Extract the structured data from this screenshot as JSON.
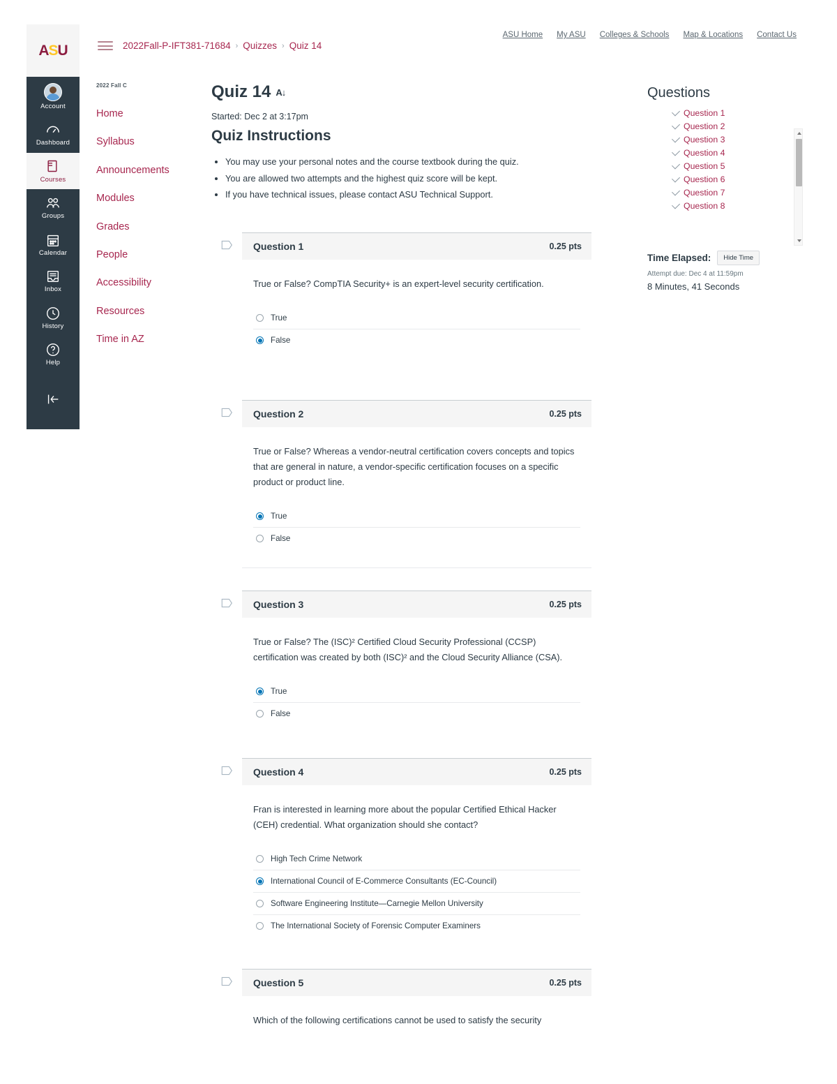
{
  "branding": {
    "logo_text": "ASU",
    "logo_primary_color": "#8C1D40",
    "logo_accent_color": "#FFC627",
    "link_color": "#A7274F",
    "radio_selected_color": "#0374B5"
  },
  "top_links": [
    {
      "label": "ASU Home"
    },
    {
      "label": "My ASU"
    },
    {
      "label": "Colleges & Schools"
    },
    {
      "label": "Map & Locations"
    },
    {
      "label": "Contact Us"
    }
  ],
  "breadcrumb": {
    "course": "2022Fall-P-IFT381-71684",
    "section": "Quizzes",
    "current": "Quiz 14",
    "separator": "›"
  },
  "global_nav": [
    {
      "label": "Account",
      "icon": "avatar-icon"
    },
    {
      "label": "Dashboard",
      "icon": "dashboard-icon"
    },
    {
      "label": "Courses",
      "icon": "courses-icon",
      "active": true
    },
    {
      "label": "Groups",
      "icon": "groups-icon"
    },
    {
      "label": "Calendar",
      "icon": "calendar-icon"
    },
    {
      "label": "Inbox",
      "icon": "inbox-icon"
    },
    {
      "label": "History",
      "icon": "history-icon"
    },
    {
      "label": "Help",
      "icon": "help-icon"
    },
    {
      "label": "",
      "icon": "collapse-arrow-icon"
    }
  ],
  "course_nav": {
    "term": "2022 Fall C",
    "items": [
      {
        "label": "Home"
      },
      {
        "label": "Syllabus"
      },
      {
        "label": "Announcements"
      },
      {
        "label": "Modules"
      },
      {
        "label": "Grades"
      },
      {
        "label": "People"
      },
      {
        "label": "Accessibility"
      },
      {
        "label": "Resources"
      },
      {
        "label": "Time in AZ"
      }
    ]
  },
  "quiz": {
    "title": "Quiz 14",
    "accessibility_icon": "A↓",
    "started": "Started: Dec 2 at 3:17pm",
    "instructions_heading": "Quiz Instructions",
    "instructions": [
      "You may use your personal notes and the course textbook during the quiz.",
      "You are allowed two attempts and the highest quiz score will be kept.",
      "If you have technical issues, please contact ASU Technical Support."
    ]
  },
  "questions": [
    {
      "name": "Question 1",
      "points": "0.25 pts",
      "text": "True or False? CompTIA Security+ is an expert-level security certification.",
      "answers": [
        {
          "label": "True",
          "selected": false
        },
        {
          "label": "False",
          "selected": true
        }
      ]
    },
    {
      "name": "Question 2",
      "points": "0.25 pts",
      "text": "True or False? Whereas a vendor-neutral certification covers concepts and topics that are general in nature, a vendor-specific certification focuses on a specific product or product line.",
      "answers": [
        {
          "label": "True",
          "selected": true
        },
        {
          "label": "False",
          "selected": false
        }
      ]
    },
    {
      "name": "Question 3",
      "points": "0.25 pts",
      "text": "True or False? The (ISC)² Certified Cloud Security Professional (CCSP) certification was created by both (ISC)² and the Cloud Security Alliance (CSA).",
      "answers": [
        {
          "label": "True",
          "selected": true
        },
        {
          "label": "False",
          "selected": false
        }
      ]
    },
    {
      "name": "Question 4",
      "points": "0.25 pts",
      "text": "Fran is interested in learning more about the popular Certified Ethical Hacker (CEH) credential. What organization should she contact?",
      "answers": [
        {
          "label": "High Tech Crime Network",
          "selected": false
        },
        {
          "label": "International Council of E-Commerce Consultants (EC-Council)",
          "selected": true
        },
        {
          "label": "Software Engineering Institute—Carnegie Mellon University",
          "selected": false
        },
        {
          "label": "The International Society of Forensic Computer Examiners",
          "selected": false
        }
      ]
    },
    {
      "name": "Question 5",
      "points": "0.25 pts",
      "text": "Which of the following certifications cannot be used to satisfy the security",
      "answers": []
    }
  ],
  "right_panel": {
    "heading": "Questions",
    "question_links": [
      {
        "label": "Question 1",
        "answered": true
      },
      {
        "label": "Question 2",
        "answered": true
      },
      {
        "label": "Question 3",
        "answered": true
      },
      {
        "label": "Question 4",
        "answered": true
      },
      {
        "label": "Question 5",
        "answered": true
      },
      {
        "label": "Question 6",
        "answered": true
      },
      {
        "label": "Question 7",
        "answered": true
      },
      {
        "label": "Question 8",
        "answered": true
      }
    ],
    "time_elapsed_label": "Time Elapsed:",
    "hide_time_button": "Hide Time",
    "attempt_due": "Attempt due: Dec 4 at 11:59pm",
    "time_elapsed_value": "8 Minutes, 41 Seconds"
  }
}
